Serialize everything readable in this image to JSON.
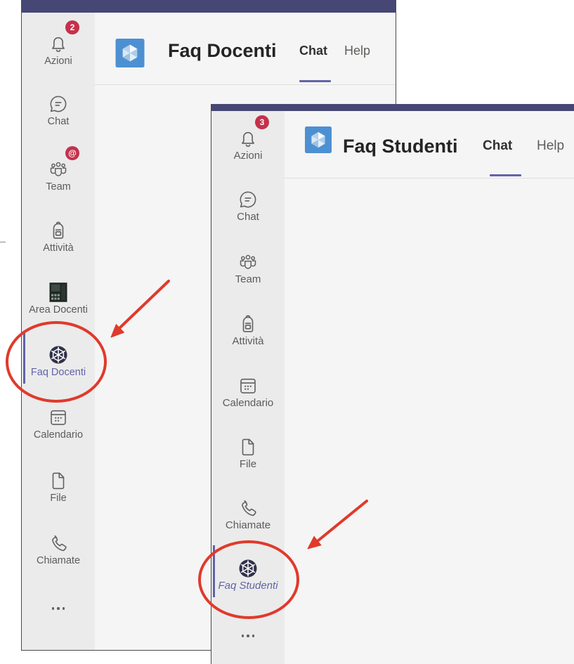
{
  "windows": {
    "docenti": {
      "app_title": "Faq Docenti",
      "app_icon": "faq-app-tile-icon",
      "tabs": [
        {
          "label": "Chat",
          "active": true
        },
        {
          "label": "Help",
          "active": false
        }
      ],
      "rail": [
        {
          "label": "Azioni",
          "icon": "bell-icon",
          "badge": "2"
        },
        {
          "label": "Chat",
          "icon": "chat-icon"
        },
        {
          "label": "Team",
          "icon": "team-icon",
          "badge": "@"
        },
        {
          "label": "Attività",
          "icon": "backpack-icon"
        },
        {
          "label": "Area Docenti",
          "icon": "area-docenti-app-icon"
        },
        {
          "label": "Faq Docenti",
          "icon": "faq-app-icon",
          "selected": true
        },
        {
          "label": "Calendario",
          "icon": "calendar-icon"
        },
        {
          "label": "File",
          "icon": "file-icon"
        },
        {
          "label": "Chiamate",
          "icon": "phone-icon"
        }
      ],
      "more_icon": "more-options-icon"
    },
    "studenti": {
      "app_title": "Faq Studenti",
      "app_icon": "faq-app-tile-icon",
      "tabs": [
        {
          "label": "Chat",
          "active": true
        },
        {
          "label": "Help",
          "active": false
        }
      ],
      "rail": [
        {
          "label": "Azioni",
          "icon": "bell-icon",
          "badge": "3"
        },
        {
          "label": "Chat",
          "icon": "chat-icon"
        },
        {
          "label": "Team",
          "icon": "team-icon"
        },
        {
          "label": "Attività",
          "icon": "backpack-icon"
        },
        {
          "label": "Calendario",
          "icon": "calendar-icon"
        },
        {
          "label": "File",
          "icon": "file-icon"
        },
        {
          "label": "Chiamate",
          "icon": "phone-icon"
        },
        {
          "label": "Faq Studenti",
          "icon": "faq-app-icon",
          "selected": true
        }
      ],
      "more_icon": "more-options-icon"
    }
  },
  "colors": {
    "top_bar": "#464775",
    "accent": "#6264a7",
    "badge": "#c4314b",
    "rail_bg": "#ebebeb",
    "content_bg": "#f5f5f5",
    "annotation": "#e03a2c"
  }
}
